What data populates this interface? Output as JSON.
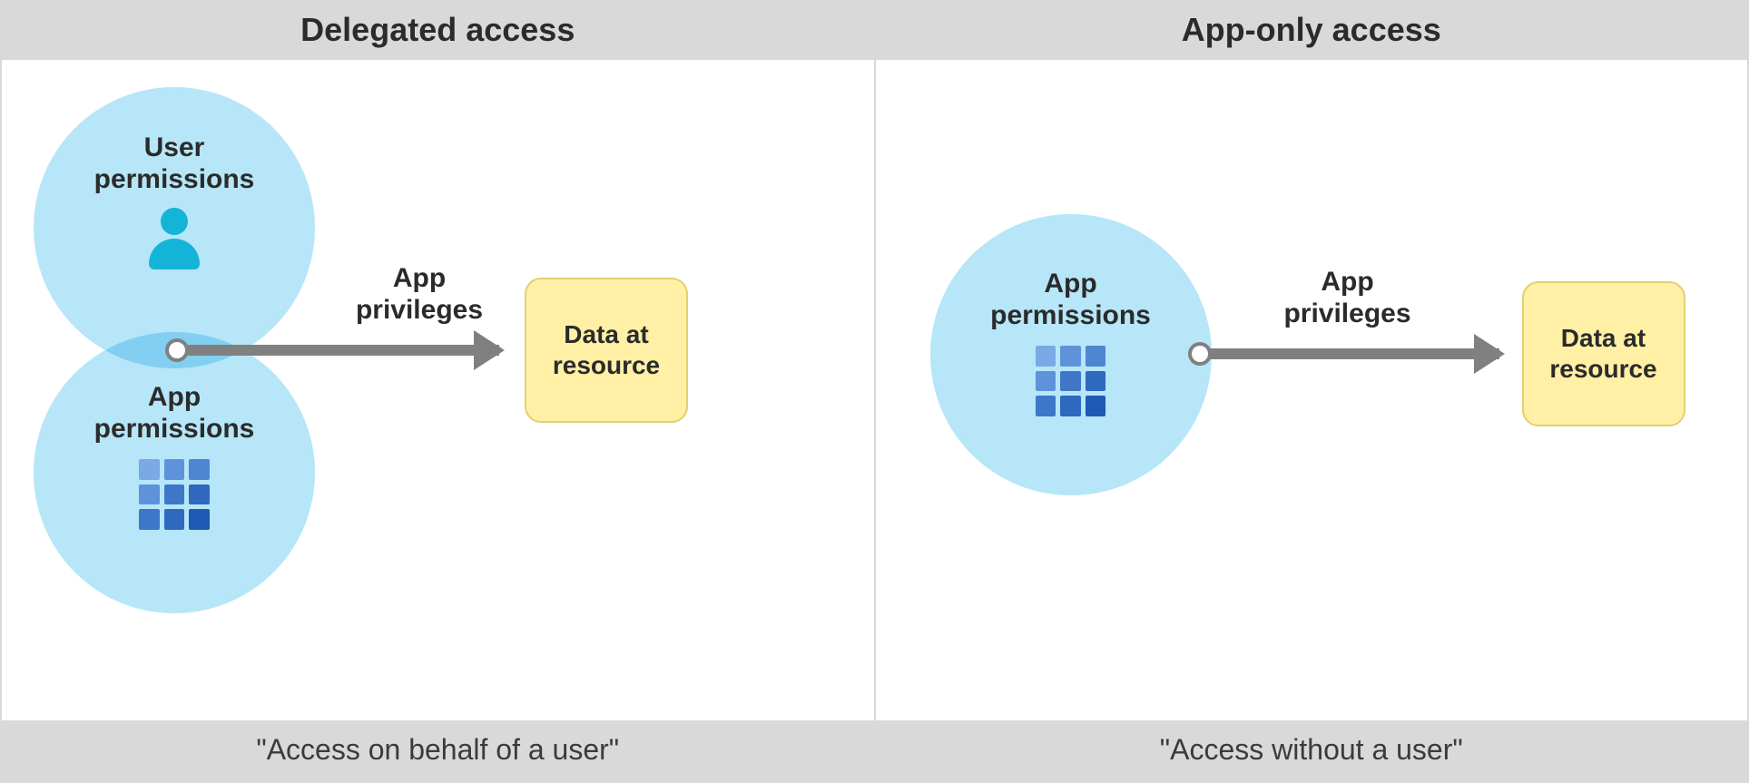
{
  "diagram": {
    "left": {
      "title": "Delegated access",
      "footer": "\"Access on behalf of a user\"",
      "user_permissions_label": "User\npermissions",
      "app_permissions_label": "App\npermissions",
      "arrow_label": "App\nprivileges",
      "data_box_label": "Data at\nresource"
    },
    "right": {
      "title": "App-only access",
      "footer": "\"Access without a user\"",
      "app_permissions_label": "App\npermissions",
      "arrow_label": "App\nprivileges",
      "data_box_label": "Data at\nresource"
    }
  },
  "colors": {
    "circle_fill": "#b6e6f8",
    "user_icon": "#14b4d8",
    "data_box_bg": "#fff0a6",
    "data_box_border": "#e2cf6f",
    "arrow": "#808080",
    "header_bg": "#d9d9d9"
  },
  "icons": {
    "user_circle_icon": "person-icon",
    "app_circle_icon": "app-grid-icon"
  }
}
